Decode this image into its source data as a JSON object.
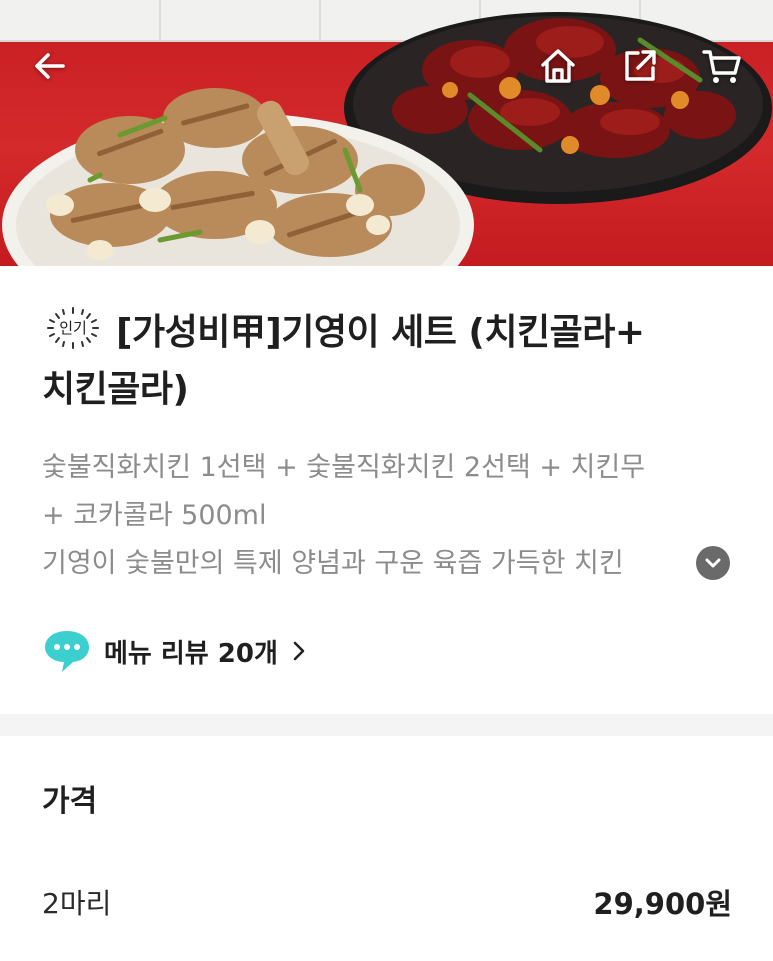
{
  "header": {
    "icons": [
      "back-arrow-icon",
      "home-icon",
      "share-icon",
      "cart-icon"
    ]
  },
  "product": {
    "badge": "인기",
    "title": "[가성비甲]기영이 세트 (치킨골라+치킨골라)",
    "title_line1": "[가성비甲]기영이 세트 (치킨골라+",
    "title_line2": "치킨골라)",
    "composition_line1": "숯불직화치킨 1선택 + 숯불직화치킨 2선택 + 치킨무",
    "composition_line2": "+ 코카콜라 500ml",
    "description_preview": "기영이 숯불만의 특제 양념과 구운 육즙 가득한 치킨"
  },
  "review": {
    "label": "메뉴 리뷰 20개",
    "icon": "speech-bubble-icon"
  },
  "price": {
    "heading": "가격",
    "options": [
      {
        "name": "2마리",
        "price": "29,900원"
      }
    ]
  },
  "colors": {
    "hero_red": "#c61d22",
    "review_bubble": "#3ccfcf",
    "text_primary": "#1f1f1f",
    "text_secondary": "#8c8c8c"
  }
}
